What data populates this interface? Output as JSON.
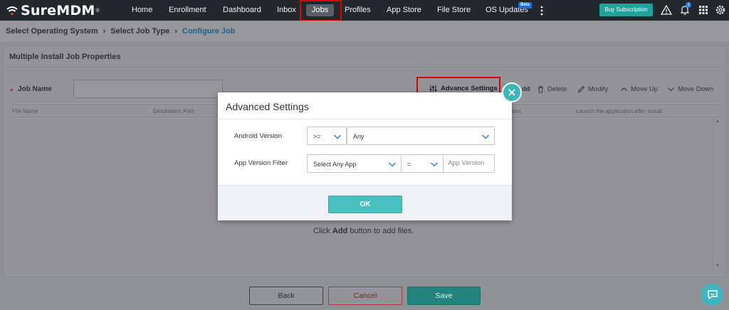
{
  "app": {
    "brand": "SureMDM",
    "brand_mark": "®"
  },
  "nav": {
    "items": [
      "Home",
      "Enrollment",
      "Dashboard",
      "Inbox",
      "Jobs",
      "Profiles",
      "App Store",
      "File Store",
      "OS Updates"
    ],
    "beta_badge": "Beta",
    "buy_label": "Buy Subscription",
    "notification_count": "1"
  },
  "breadcrumb": {
    "step1": "Select Operating System",
    "step2": "Select Job Type",
    "step3": "Configure Job"
  },
  "panel": {
    "title": "Multiple Install Job Properties",
    "job_name_label": "Job Name",
    "required_mark": "*"
  },
  "toolbar": {
    "advance_settings": "Advance Settings",
    "add_partial": "dd",
    "delete": "Delete",
    "modify": "Modify",
    "move_up": "Move Up",
    "move_down": "Move Down"
  },
  "table": {
    "headers": [
      "File Name",
      "Destination Path",
      "tion",
      "Launch the application after install"
    ]
  },
  "hint": {
    "prefix": "Click ",
    "bold": "Add",
    "suffix": " button to add files."
  },
  "footer": {
    "back": "Back",
    "cancel": "Cancel",
    "save": "Save"
  },
  "modal": {
    "title": "Advanced Settings",
    "android_version_label": "Android Version",
    "android_operator": ">=",
    "android_version_value": "Any",
    "app_version_filter_label": "App Version Filter",
    "app_select_value": "Select Any App",
    "app_operator": "=",
    "app_version_placeholder": "App Version",
    "ok": "OK"
  },
  "colors": {
    "topbar": "#23272e",
    "accent": "#48c0bf",
    "highlight": "#e00000",
    "link": "#1f5f8a"
  }
}
